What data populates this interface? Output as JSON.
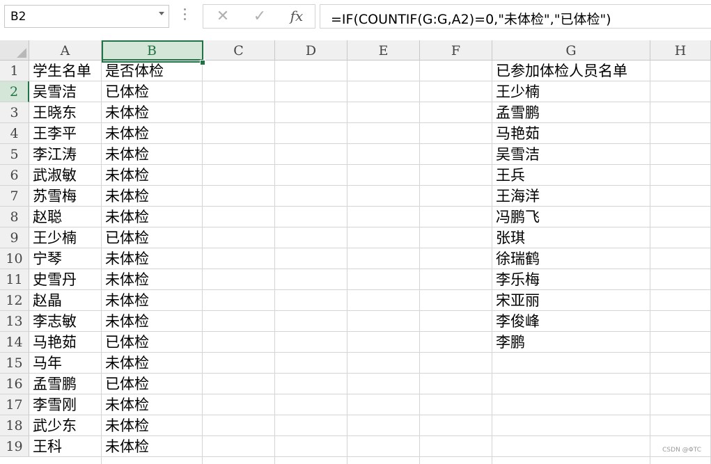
{
  "name_box": "B2",
  "formula": "=IF(COUNTIF(G:G,A2)=0,\"未体检\",\"已体检\")",
  "formula_buttons": {
    "cancel": "✕",
    "enter": "✓",
    "fx": "fx"
  },
  "columns": [
    "A",
    "B",
    "C",
    "D",
    "E",
    "F",
    "G",
    "H"
  ],
  "selected_column": "B",
  "selected_row": 2,
  "rows": [
    {
      "n": "1",
      "A": "学生名单",
      "B": "是否体检",
      "G": "已参加体检人员名单"
    },
    {
      "n": "2",
      "A": "吴雪洁",
      "B": "已体检",
      "G": "王少楠"
    },
    {
      "n": "3",
      "A": "王晓东",
      "B": "未体检",
      "G": "孟雪鹏"
    },
    {
      "n": "4",
      "A": "王李平",
      "B": "未体检",
      "G": "马艳茹"
    },
    {
      "n": "5",
      "A": "李江涛",
      "B": "未体检",
      "G": "吴雪洁"
    },
    {
      "n": "6",
      "A": "武淑敏",
      "B": "未体检",
      "G": "王兵"
    },
    {
      "n": "7",
      "A": "苏雪梅",
      "B": "未体检",
      "G": "王海洋"
    },
    {
      "n": "8",
      "A": "赵聪",
      "B": "未体检",
      "G": "冯鹏飞"
    },
    {
      "n": "9",
      "A": "王少楠",
      "B": "已体检",
      "G": "张琪"
    },
    {
      "n": "10",
      "A": "宁琴",
      "B": "未体检",
      "G": "徐瑞鹤"
    },
    {
      "n": "11",
      "A": "史雪丹",
      "B": "未体检",
      "G": "李乐梅"
    },
    {
      "n": "12",
      "A": "赵晶",
      "B": "未体检",
      "G": "宋亚丽"
    },
    {
      "n": "13",
      "A": "李志敏",
      "B": "未体检",
      "G": "李俊峰"
    },
    {
      "n": "14",
      "A": "马艳茹",
      "B": "已体检",
      "G": "李鹏"
    },
    {
      "n": "15",
      "A": "马年",
      "B": "未体检",
      "G": ""
    },
    {
      "n": "16",
      "A": "孟雪鹏",
      "B": "已体检",
      "G": ""
    },
    {
      "n": "17",
      "A": "李雪刚",
      "B": "未体检",
      "G": ""
    },
    {
      "n": "18",
      "A": "武少东",
      "B": "未体检",
      "G": ""
    },
    {
      "n": "19",
      "A": "王科",
      "B": "未体检",
      "G": ""
    }
  ],
  "watermark": "CSDN @ΦTC",
  "accent_color": "#217346"
}
